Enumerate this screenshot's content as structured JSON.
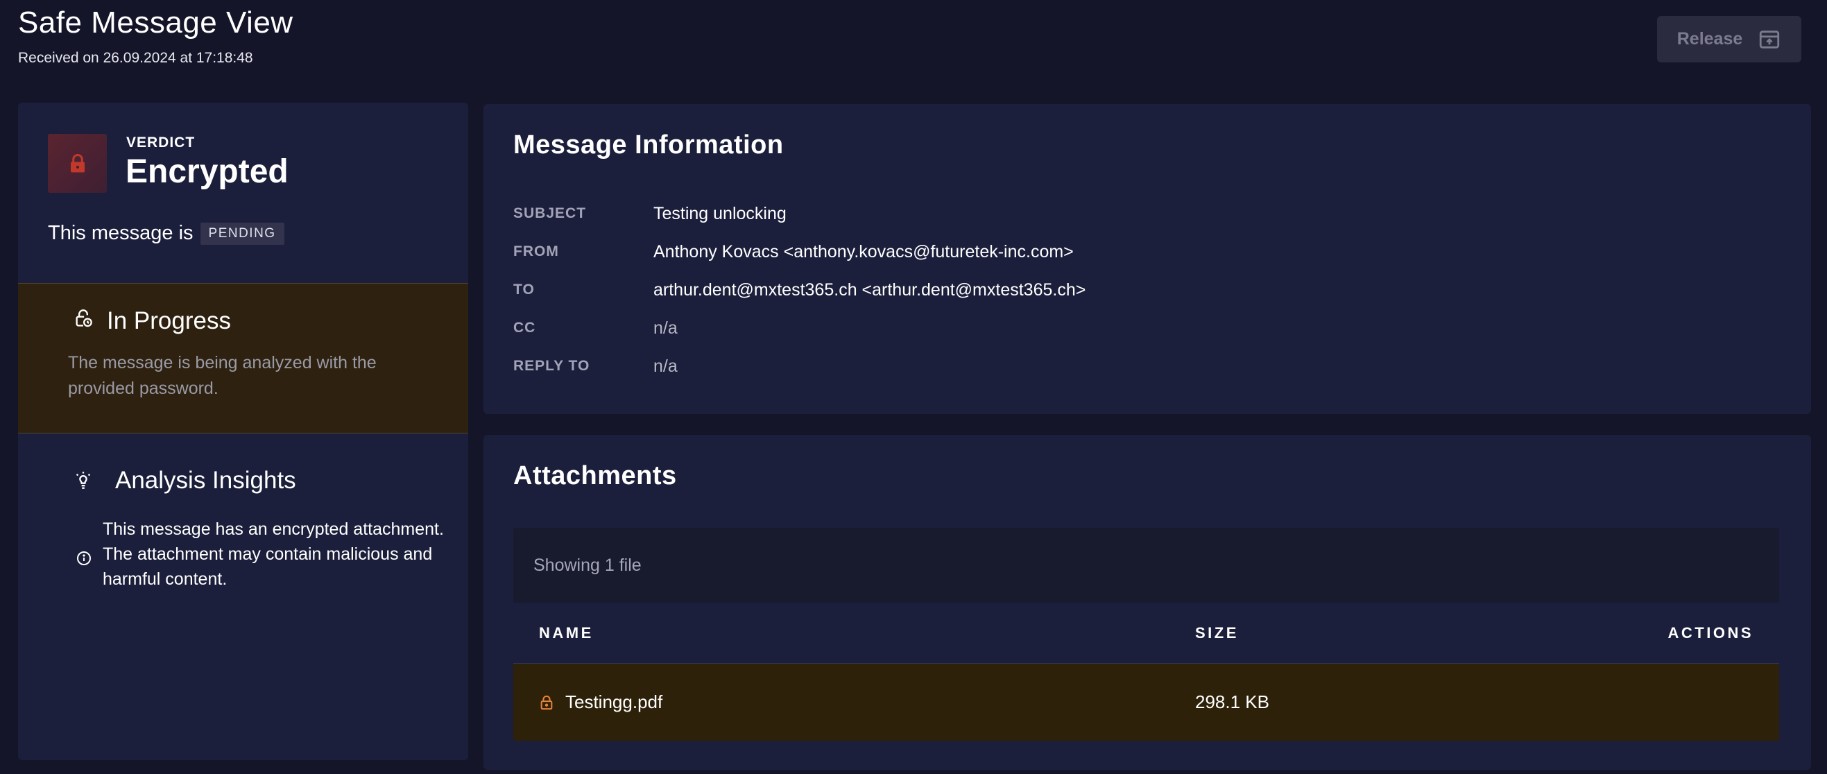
{
  "header": {
    "title": "Safe Message View",
    "received": "Received on 26.09.2024 at 17:18:48",
    "release_label": "Release"
  },
  "verdict": {
    "label": "VERDICT",
    "value": "Encrypted",
    "status_prefix": "This message is",
    "status_badge": "PENDING",
    "accent_color": "#c0392b"
  },
  "progress": {
    "title": "In Progress",
    "description": "The message is being analyzed with the provided password."
  },
  "insights": {
    "title": "Analysis Insights",
    "items": [
      "This message has an encrypted attachment. The attachment may contain malicious and harmful content."
    ]
  },
  "message_info": {
    "title": "Message Information",
    "rows": [
      {
        "label": "SUBJECT",
        "value": "Testing unlocking"
      },
      {
        "label": "FROM",
        "value": "Anthony Kovacs <anthony.kovacs@futuretek-inc.com>"
      },
      {
        "label": "TO",
        "value": "arthur.dent@mxtest365.ch <arthur.dent@mxtest365.ch>"
      },
      {
        "label": "CC",
        "value": "n/a"
      },
      {
        "label": "REPLY TO",
        "value": "n/a"
      }
    ]
  },
  "attachments": {
    "title": "Attachments",
    "count_text": "Showing 1 file",
    "columns": {
      "name": "NAME",
      "size": "SIZE",
      "actions": "ACTIONS"
    },
    "files": [
      {
        "name": "Testingg.pdf",
        "size": "298.1 KB",
        "icon": "lock-icon",
        "icon_color": "#e8833a"
      }
    ]
  }
}
